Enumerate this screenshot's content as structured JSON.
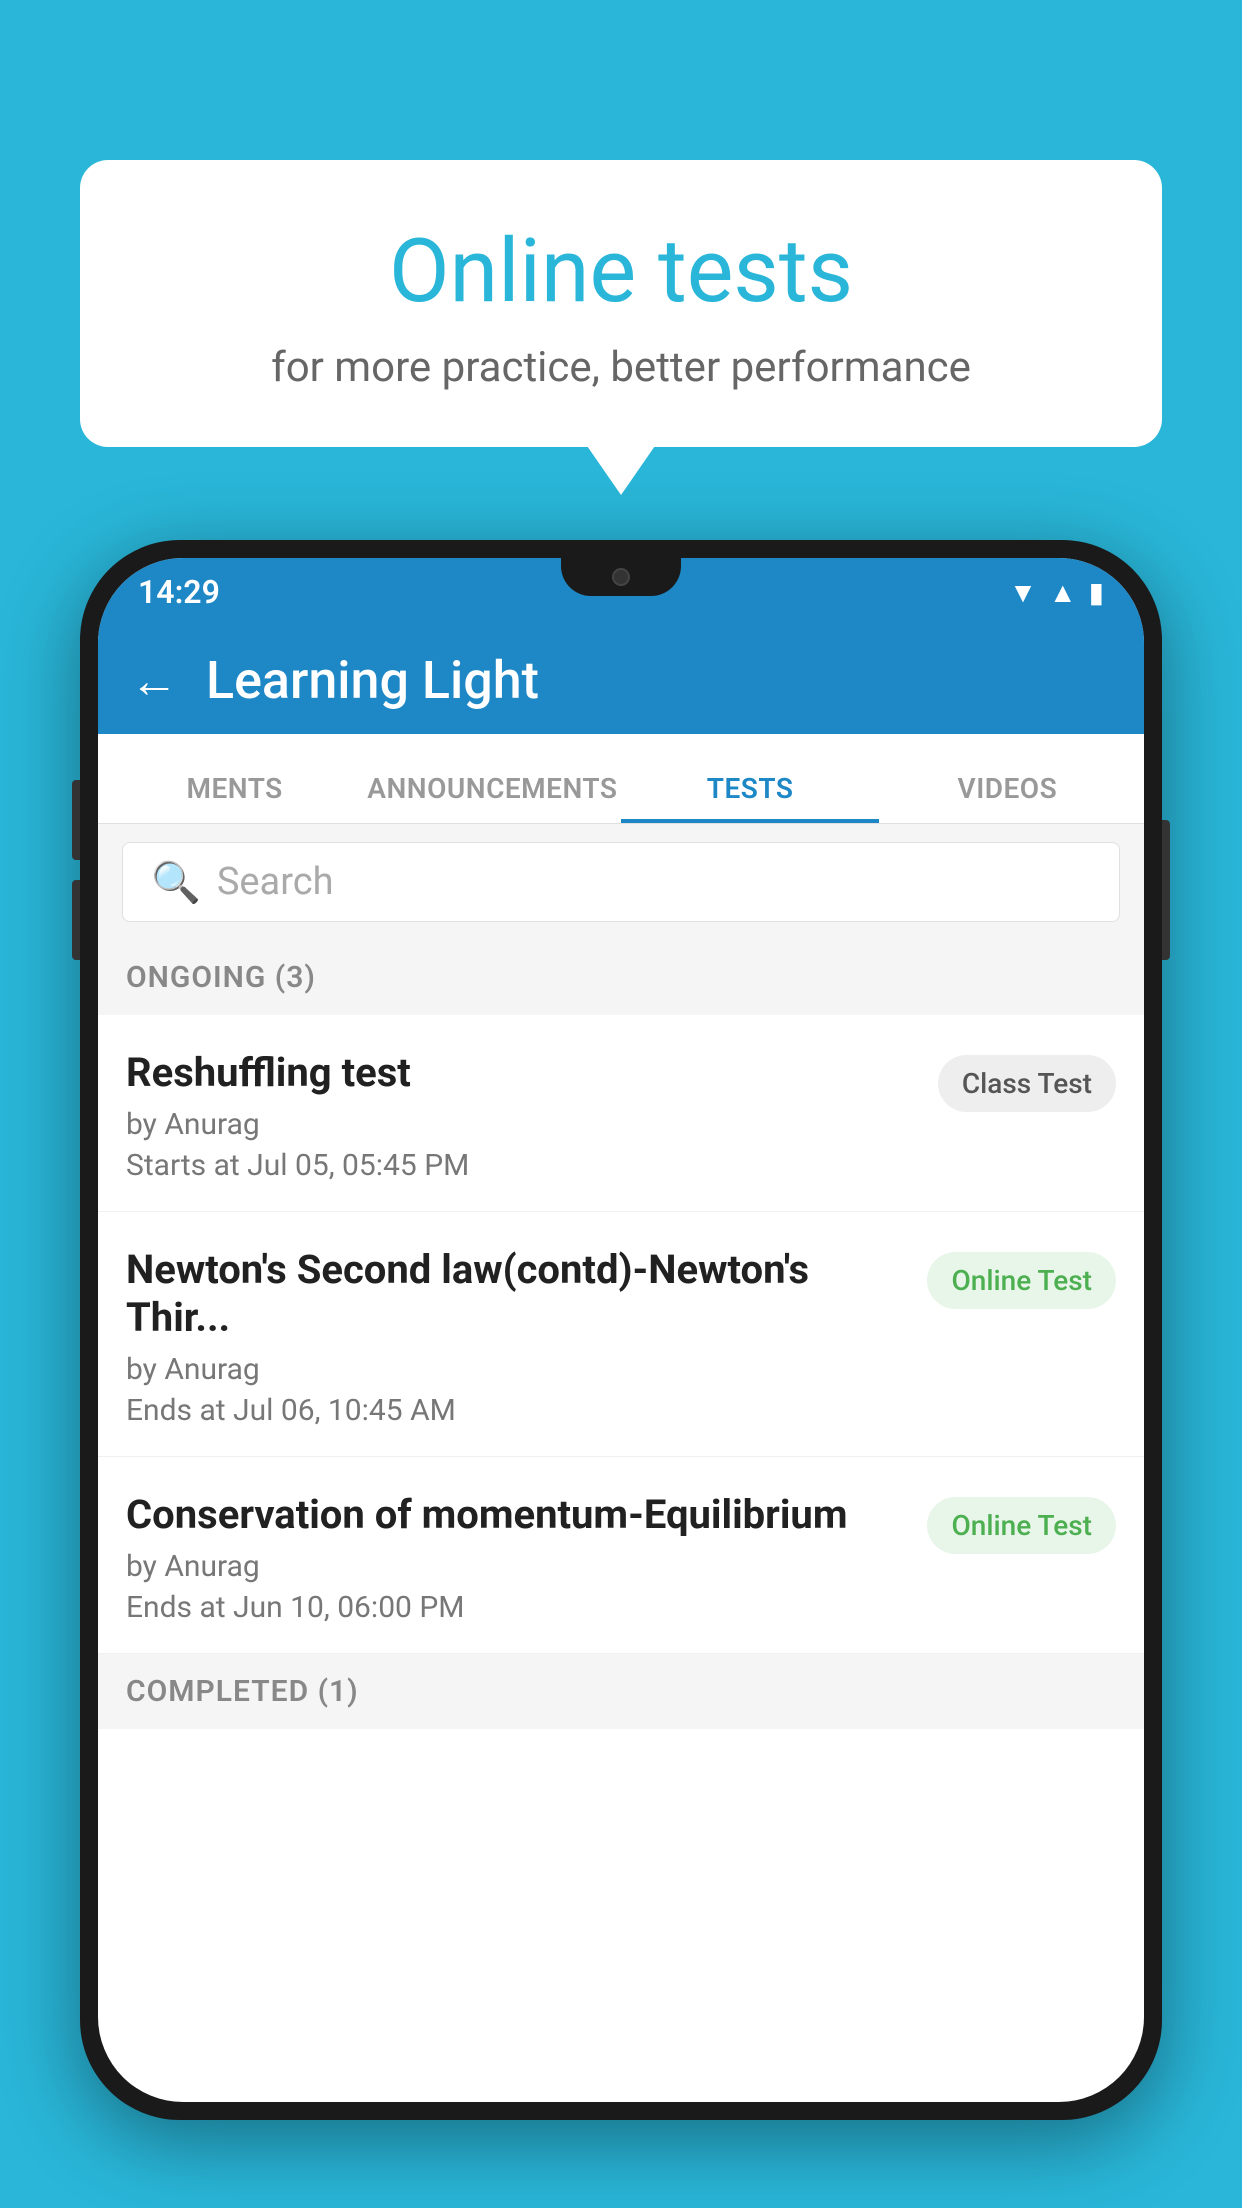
{
  "background_color": "#29b6d8",
  "bubble": {
    "title": "Online tests",
    "subtitle": "for more practice, better performance"
  },
  "phone": {
    "status_bar": {
      "time": "14:29",
      "icons": [
        "wifi",
        "signal",
        "battery"
      ]
    },
    "app_bar": {
      "title": "Learning Light",
      "back_label": "←"
    },
    "tabs": [
      {
        "label": "MENTS",
        "active": false
      },
      {
        "label": "ANNOUNCEMENTS",
        "active": false
      },
      {
        "label": "TESTS",
        "active": true
      },
      {
        "label": "VIDEOS",
        "active": false
      }
    ],
    "search": {
      "placeholder": "Search"
    },
    "sections": [
      {
        "title": "ONGOING (3)",
        "tests": [
          {
            "name": "Reshuffling test",
            "author": "by Anurag",
            "date": "Starts at  Jul 05, 05:45 PM",
            "badge": "Class Test",
            "badge_type": "class"
          },
          {
            "name": "Newton's Second law(contd)-Newton's Thir...",
            "author": "by Anurag",
            "date": "Ends at  Jul 06, 10:45 AM",
            "badge": "Online Test",
            "badge_type": "online"
          },
          {
            "name": "Conservation of momentum-Equilibrium",
            "author": "by Anurag",
            "date": "Ends at  Jun 10, 06:00 PM",
            "badge": "Online Test",
            "badge_type": "online"
          }
        ]
      },
      {
        "title": "COMPLETED (1)",
        "tests": []
      }
    ]
  }
}
